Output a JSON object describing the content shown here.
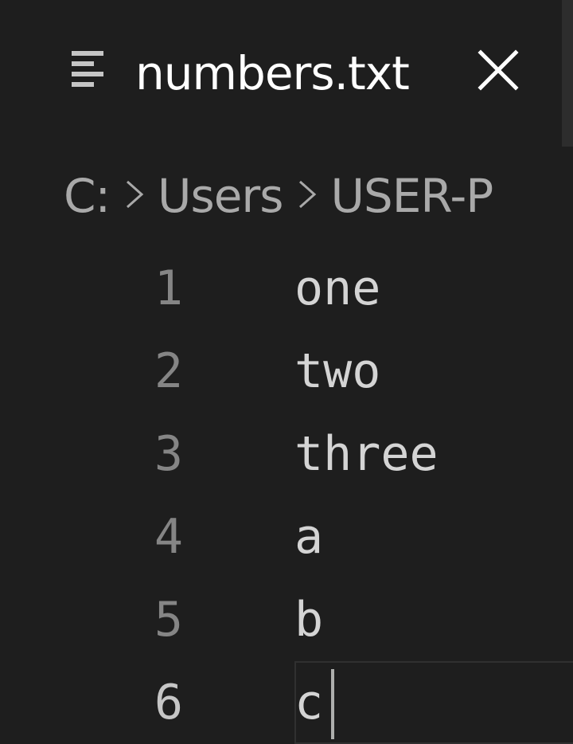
{
  "tab": {
    "title": "numbers.txt",
    "file_icon": "file-lines-icon",
    "close_icon": "close-icon"
  },
  "breadcrumb": {
    "items": [
      "C:",
      "Users",
      "USER-P"
    ],
    "separator_icon": "chevron-right-icon"
  },
  "editor": {
    "lines": [
      {
        "number": "1",
        "text": "one"
      },
      {
        "number": "2",
        "text": "two"
      },
      {
        "number": "3",
        "text": "three"
      },
      {
        "number": "4",
        "text": "a"
      },
      {
        "number": "5",
        "text": "b"
      },
      {
        "number": "6",
        "text": "c"
      }
    ],
    "active_line": 6
  },
  "colors": {
    "background": "#1e1e1e",
    "tab_text": "#ffffff",
    "breadcrumb_text": "#a9a9a9",
    "line_number": "#858585",
    "active_line_number": "#c6c6c6",
    "code_text": "#d4d4d4"
  }
}
